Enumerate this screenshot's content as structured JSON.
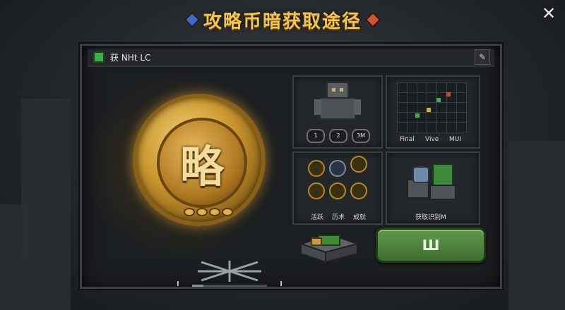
{
  "title": "攻略币暗获取途径",
  "close_icon": "close-icon",
  "panel": {
    "header_label": "获 NHt LC",
    "edit_icon": "pencil-icon"
  },
  "coin": {
    "glyph": "略",
    "slider": {
      "left_label": "I",
      "right_label": "I",
      "value": 0.15
    }
  },
  "tiles": [
    {
      "id": "boss",
      "icon": "golem-icon",
      "badges": [
        "1",
        "2",
        "3M"
      ]
    },
    {
      "id": "map",
      "icon": "grid-map-icon",
      "labels": [
        "Final",
        "Vive",
        "MUI"
      ]
    },
    {
      "id": "rewards",
      "icon": "reward-badges-icon",
      "labels": [
        "活跃",
        "历术",
        "成就"
      ]
    },
    {
      "id": "materials",
      "icon": "ore-icon",
      "label": "获取识别M"
    }
  ],
  "chest_icon": "treasure-chest-icon",
  "confirm": {
    "label": "Ш"
  },
  "colors": {
    "title": "#f2c84b",
    "coin_gold": "#c8962c",
    "confirm_green": "#4f8a3c",
    "panel_bg": "#1c1f21"
  }
}
